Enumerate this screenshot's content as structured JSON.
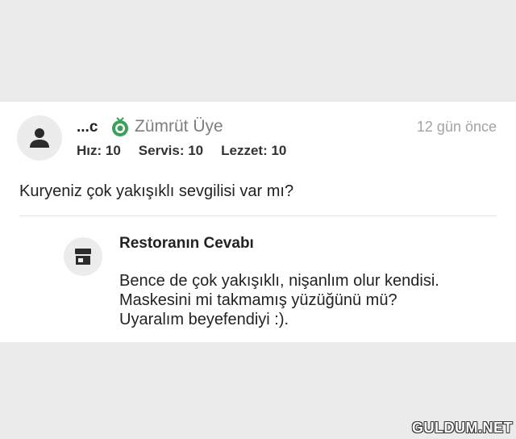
{
  "review": {
    "username": "...c",
    "membership": "Zümrüt Üye",
    "time_ago": "12 gün önce",
    "ratings": [
      {
        "label": "Hız: 10"
      },
      {
        "label": "Servis: 10"
      },
      {
        "label": "Lezzet: 10"
      }
    ],
    "comment": "Kuryeniz çok yakışıklı sevgilisi var mı?",
    "icons": {
      "avatar": "user-icon",
      "badge": "emerald-badge-icon"
    }
  },
  "reply": {
    "title": "Restoranın Cevabı",
    "lines": [
      "Bence de çok yakışıklı, nişanlım olur kendisi.",
      "Maskesini mi takmamış yüzüğünü mü?",
      "Uyaralım beyefendiyi :)."
    ],
    "icon": "store-icon"
  },
  "watermark": "GULDUM.NET",
  "colors": {
    "badge": "#3aa05a",
    "background": "#ebebeb",
    "card": "#ffffff"
  }
}
